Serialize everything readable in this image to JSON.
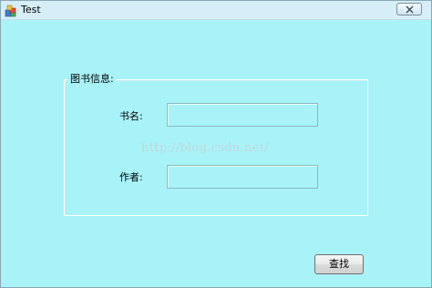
{
  "window": {
    "title": "Test"
  },
  "group": {
    "legend": "图书信息:"
  },
  "fields": {
    "book_name_label": "书名:",
    "book_name_value": "",
    "author_label": "作者:",
    "author_value": ""
  },
  "watermark": {
    "text": "http://blog.csdn.net/"
  },
  "actions": {
    "search_label": "查找"
  },
  "icons": {
    "app": "app-icon",
    "close": "close-icon"
  },
  "colors": {
    "background": "#a7f3f8",
    "titlebar": "#d6eef7"
  }
}
